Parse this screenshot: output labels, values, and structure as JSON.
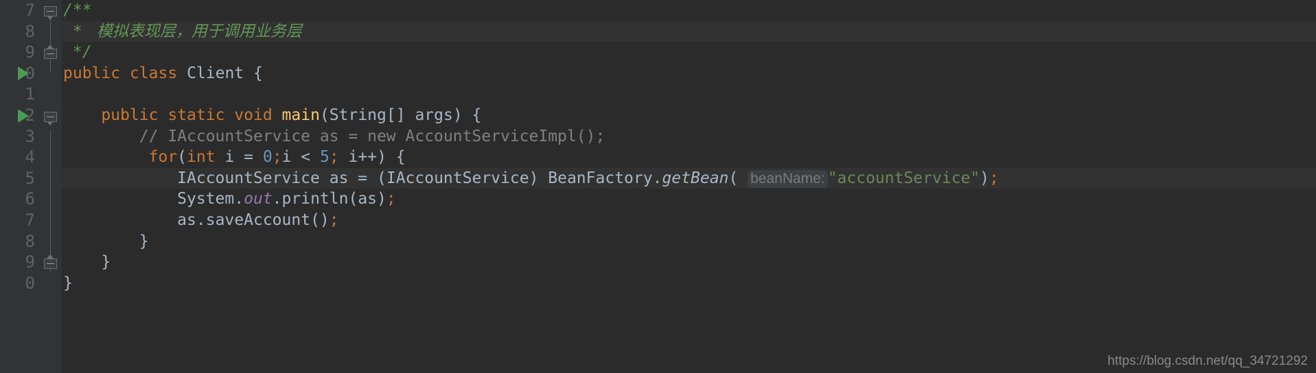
{
  "editor": {
    "theme_name": "darcula",
    "background": "#2b2b2b",
    "gutter_background": "#313335",
    "current_line_background": "#323232",
    "line_number_color": "#606366",
    "default_text_color": "#a9b7c6",
    "keyword_color": "#cc7832",
    "string_color": "#6a8759",
    "number_color": "#6897bb",
    "doc_comment_color": "#629755",
    "line_comment_color": "#808080",
    "method_name_color": "#ffc66d",
    "static_field_color": "#9876aa",
    "run_marker_color": "#499c54",
    "param_hint_background": "#3d3f41",
    "param_hint_color": "#7a7a7a"
  },
  "gutter": {
    "line_numbers": [
      "7",
      "8",
      "9",
      "0",
      "1",
      "2",
      "3",
      "4",
      "5",
      "6",
      "7",
      "8",
      "9",
      "0"
    ],
    "run_markers": [
      {
        "line_index": 3,
        "name": "run-class-marker"
      },
      {
        "line_index": 5,
        "name": "run-method-marker"
      }
    ],
    "fold_markers": [
      {
        "line_index": 0,
        "type": "expanded-open"
      },
      {
        "line_index": 2,
        "type": "expanded-close"
      },
      {
        "line_index": 5,
        "type": "expanded-open"
      },
      {
        "line_index": 12,
        "type": "expanded-close"
      }
    ]
  },
  "code": {
    "language": "Java",
    "lines": [
      {
        "number": "7",
        "text": "/**",
        "highlight": false
      },
      {
        "number": "8",
        "text": " *  模拟表现层，用于调用业务层",
        "highlight": true
      },
      {
        "number": "9",
        "text": " */",
        "highlight": false
      },
      {
        "number": "0",
        "text": "public class Client {",
        "highlight": false
      },
      {
        "number": "1",
        "text": "",
        "highlight": false
      },
      {
        "number": "2",
        "text": "    public static void main(String[] args) {",
        "highlight": false
      },
      {
        "number": "3",
        "text": "        // IAccountService as = new AccountServiceImpl();",
        "highlight": false
      },
      {
        "number": "4",
        "text": "        for(int i = 0;i < 5; i++) {",
        "highlight": false
      },
      {
        "number": "5",
        "text": "            IAccountService as = (IAccountService) BeanFactory.getBean( beanName: \"accountService\");",
        "highlight": true
      },
      {
        "number": "6",
        "text": "            System.out.println(as);",
        "highlight": false
      },
      {
        "number": "7",
        "text": "            as.saveAccount();",
        "highlight": false
      },
      {
        "number": "8",
        "text": "        }",
        "highlight": false
      },
      {
        "number": "9",
        "text": "    }",
        "highlight": false
      },
      {
        "number": "0",
        "text": "}",
        "highlight": false
      }
    ],
    "tokens": {
      "doc_open": "/**",
      "doc_star": " * ",
      "doc_comment_cjk": " 模拟表现层，用于调用业务层",
      "doc_close": " */",
      "kw_public": "public",
      "kw_class": "class",
      "class_name_client": "Client",
      "kw_static": "static",
      "kw_void": "void",
      "method_main": "main",
      "type_string": "String",
      "param_args": "args",
      "line_comment": "// IAccountService as = new AccountServiceImpl();",
      "kw_for": "for",
      "kw_int": "int",
      "var_i": "i",
      "num_zero": "0",
      "num_five": "5",
      "type_iaccountservice": "IAccountService",
      "var_as": "as",
      "class_beanfactory": "BeanFactory",
      "method_getbean": "getBean",
      "param_hint_beanname": "beanName:",
      "string_accountservice": "\"accountService\"",
      "class_system": "System",
      "field_out": "out",
      "method_println": "println",
      "method_saveaccount": "saveAccount"
    }
  },
  "watermark": {
    "text": "https://blog.csdn.net/qq_34721292"
  }
}
